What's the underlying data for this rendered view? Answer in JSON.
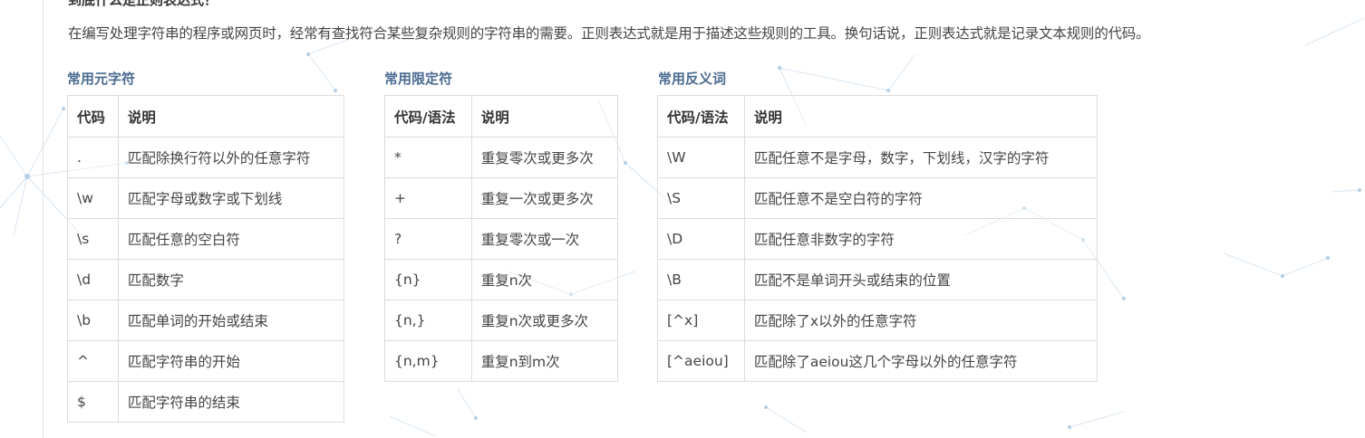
{
  "article": {
    "heading": "到底什么是正则表达式？",
    "intro": "在编写处理字符串的程序或网页时，经常有查找符合某些复杂规则的字符串的需要。正则表达式就是用于描述这些规则的工具。换句话说，正则表达式就是记录文本规则的代码。"
  },
  "colors": {
    "section_title": "#4a6a90",
    "border": "#dcdcdc",
    "text": "#444444"
  },
  "metachars": {
    "title": "常用元字符",
    "headers": [
      "代码",
      "说明"
    ],
    "rows": [
      [
        ".",
        "匹配除换行符以外的任意字符"
      ],
      [
        "\\w",
        "匹配字母或数字或下划线"
      ],
      [
        "\\s",
        "匹配任意的空白符"
      ],
      [
        "\\d",
        "匹配数字"
      ],
      [
        "\\b",
        "匹配单词的开始或结束"
      ],
      [
        "^",
        "匹配字符串的开始"
      ],
      [
        "$",
        "匹配字符串的结束"
      ]
    ]
  },
  "quantifiers": {
    "title": "常用限定符",
    "headers": [
      "代码/语法",
      "说明"
    ],
    "rows": [
      [
        "*",
        "重复零次或更多次"
      ],
      [
        "+",
        "重复一次或更多次"
      ],
      [
        "?",
        "重复零次或一次"
      ],
      [
        "{n}",
        "重复n次"
      ],
      [
        "{n,}",
        "重复n次或更多次"
      ],
      [
        "{n,m}",
        "重复n到m次"
      ]
    ]
  },
  "antonyms": {
    "title": "常用反义词",
    "headers": [
      "代码/语法",
      "说明"
    ],
    "rows": [
      [
        "\\W",
        "匹配任意不是字母，数字，下划线，汉字的字符"
      ],
      [
        "\\S",
        "匹配任意不是空白符的字符"
      ],
      [
        "\\D",
        "匹配任意非数字的字符"
      ],
      [
        "\\B",
        "匹配不是单词开头或结束的位置"
      ],
      [
        "[^x]",
        "匹配除了x以外的任意字符"
      ],
      [
        "[^aeiou]",
        "匹配除了aeiou这几个字母以外的任意字符"
      ]
    ]
  }
}
